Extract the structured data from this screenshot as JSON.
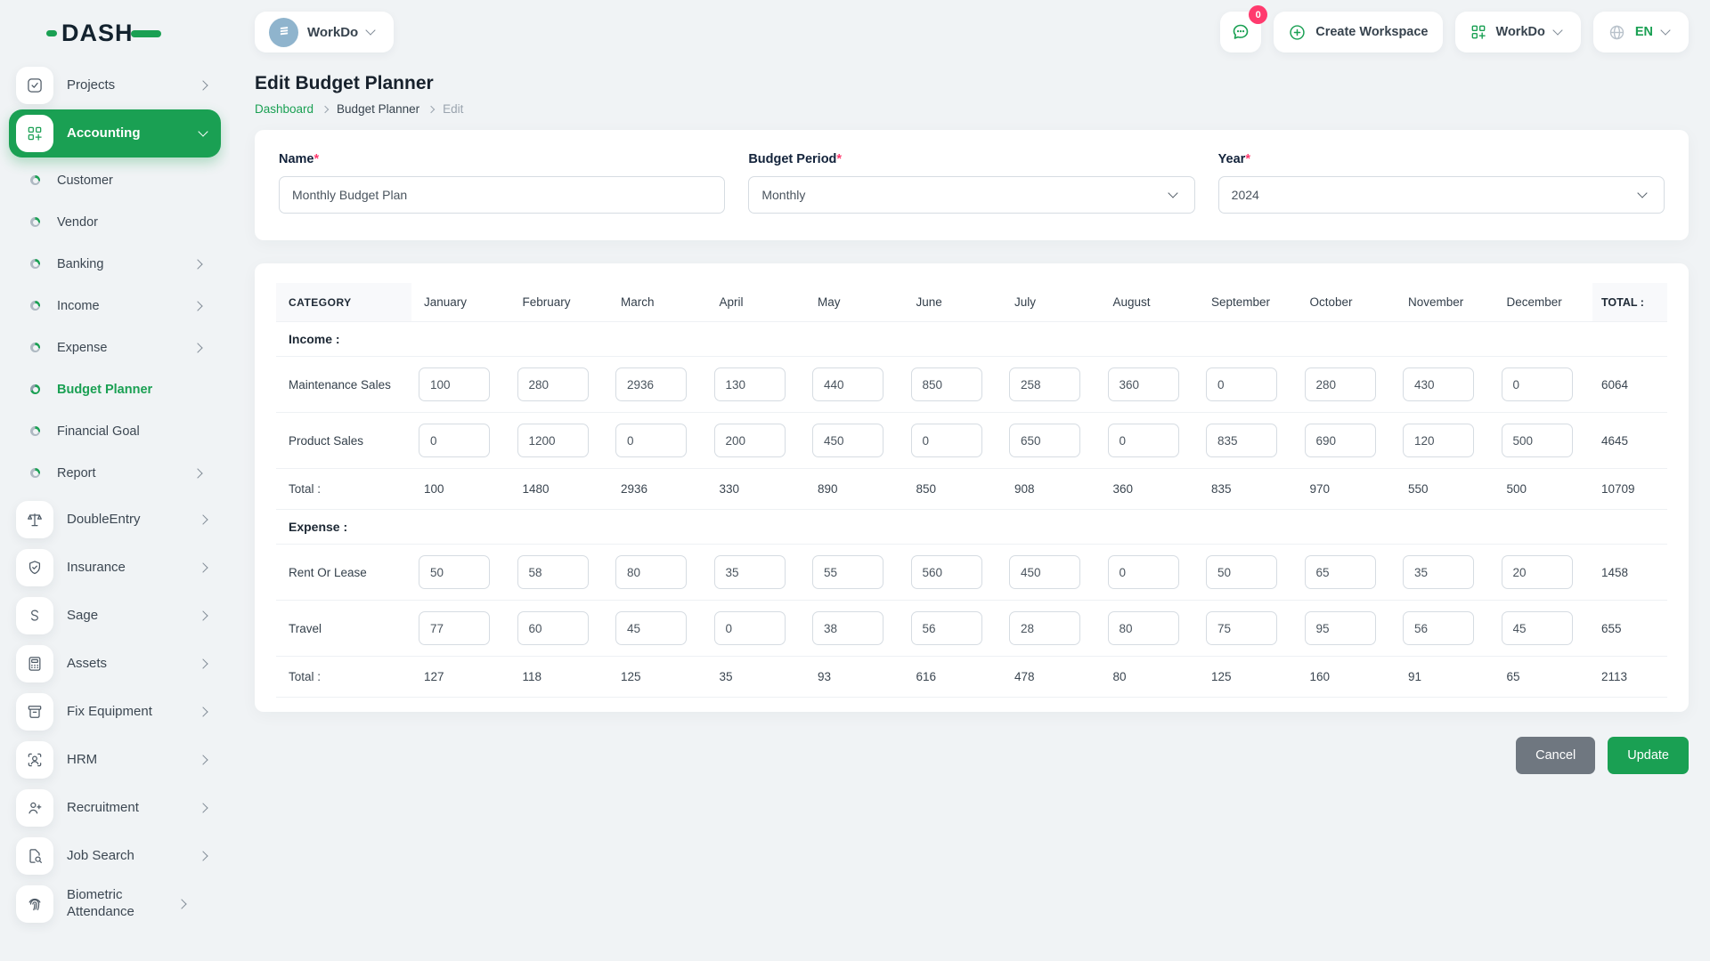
{
  "brand": {
    "name": "DASH"
  },
  "topbar": {
    "workspace": {
      "name": "WorkDo"
    },
    "chat_badge": "0",
    "create_workspace_label": "Create Workspace",
    "user_menu_label": "WorkDo",
    "language": "EN"
  },
  "sidebar": {
    "items": [
      {
        "label": "Projects"
      },
      {
        "label": "Accounting"
      },
      {
        "label": "DoubleEntry"
      },
      {
        "label": "Insurance"
      },
      {
        "label": "Sage"
      },
      {
        "label": "Assets"
      },
      {
        "label": "Fix Equipment"
      },
      {
        "label": "HRM"
      },
      {
        "label": "Recruitment"
      },
      {
        "label": "Job Search"
      },
      {
        "label": "Biometric Attendance"
      }
    ],
    "accounting_children": [
      {
        "label": "Customer"
      },
      {
        "label": "Vendor"
      },
      {
        "label": "Banking"
      },
      {
        "label": "Income"
      },
      {
        "label": "Expense"
      },
      {
        "label": "Budget Planner"
      },
      {
        "label": "Financial Goal"
      },
      {
        "label": "Report"
      }
    ]
  },
  "page": {
    "title": "Edit Budget Planner",
    "breadcrumb": {
      "home": "Dashboard",
      "section": "Budget Planner",
      "current": "Edit"
    }
  },
  "form": {
    "required_mark": "*",
    "name": {
      "label": "Name",
      "value": "Monthly Budget Plan"
    },
    "period": {
      "label": "Budget Period",
      "value": "Monthly"
    },
    "year": {
      "label": "Year",
      "value": "2024"
    }
  },
  "budget_table": {
    "category_header": "CATEGORY",
    "months": [
      "January",
      "February",
      "March",
      "April",
      "May",
      "June",
      "July",
      "August",
      "September",
      "October",
      "November",
      "December"
    ],
    "total_header": "TOTAL :",
    "total_row_label": "Total :",
    "sections": [
      {
        "title": "Income :",
        "rows": [
          {
            "label": "Maintenance Sales",
            "values": [
              100,
              280,
              2936,
              130,
              440,
              850,
              258,
              360,
              0,
              280,
              430,
              0
            ],
            "total": 6064
          },
          {
            "label": "Product Sales",
            "values": [
              0,
              1200,
              0,
              200,
              450,
              0,
              650,
              0,
              835,
              690,
              120,
              500
            ],
            "total": 4645
          }
        ],
        "totals": {
          "values": [
            100,
            1480,
            2936,
            330,
            890,
            850,
            908,
            360,
            835,
            970,
            550,
            500
          ],
          "total": 10709
        }
      },
      {
        "title": "Expense :",
        "rows": [
          {
            "label": "Rent Or Lease",
            "values": [
              50,
              58,
              80,
              35,
              55,
              560,
              450,
              0,
              50,
              65,
              35,
              20
            ],
            "total": 1458
          },
          {
            "label": "Travel",
            "values": [
              77,
              60,
              45,
              0,
              38,
              56,
              28,
              80,
              75,
              95,
              56,
              45
            ],
            "total": 655
          }
        ],
        "totals": {
          "values": [
            127,
            118,
            125,
            35,
            93,
            616,
            478,
            80,
            125,
            160,
            91,
            65
          ],
          "total": 2113
        }
      }
    ]
  },
  "actions": {
    "cancel": "Cancel",
    "update": "Update"
  },
  "colors": {
    "primary": "#1aa053",
    "danger": "#ff3a6e",
    "cancel": "#6f7780"
  }
}
